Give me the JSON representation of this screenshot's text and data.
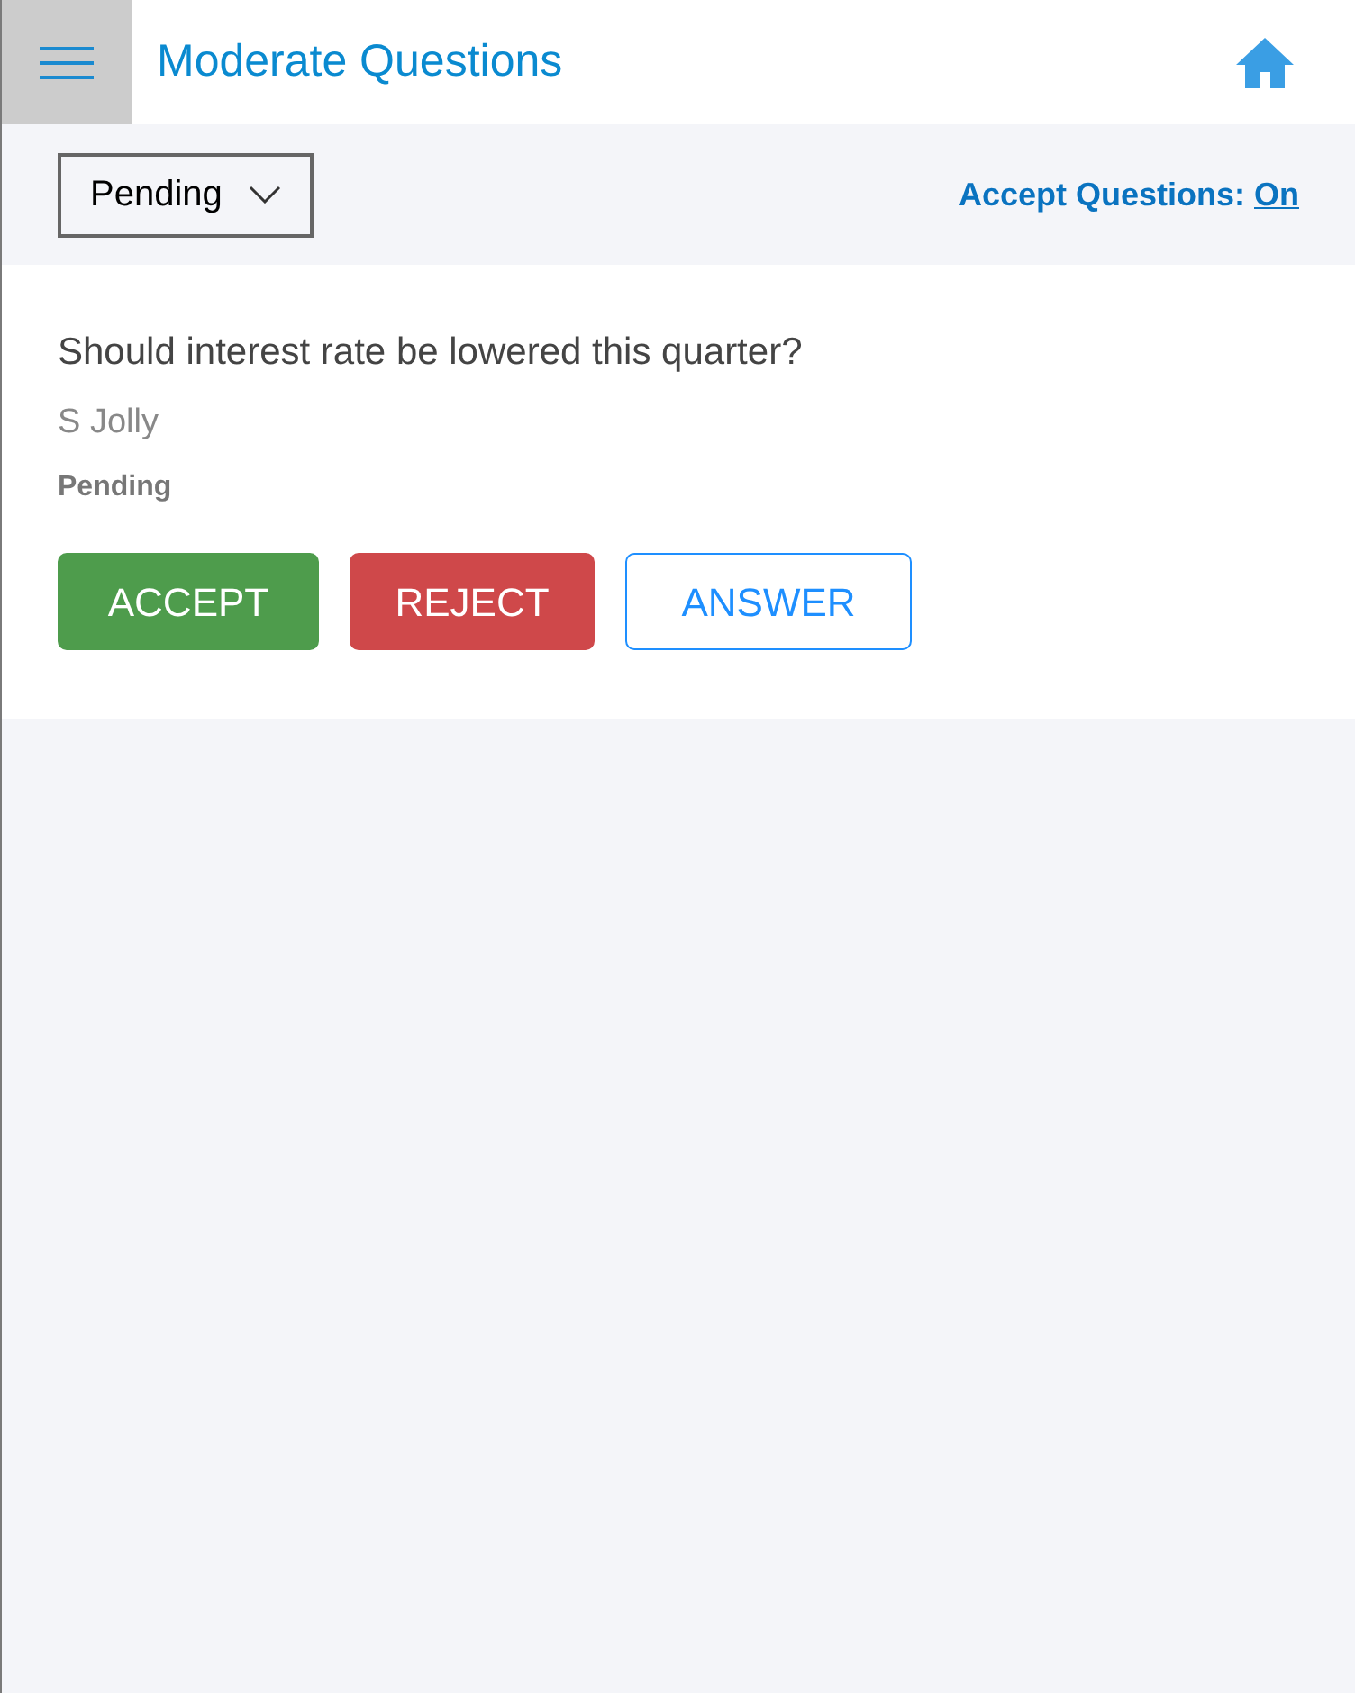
{
  "header": {
    "title": "Moderate Questions"
  },
  "toolbar": {
    "filter": {
      "value": "Pending"
    },
    "accept_questions": {
      "label": "Accept Questions:",
      "value": "On"
    }
  },
  "questions": [
    {
      "text": "Should interest rate be lowered this quarter?",
      "author": "S Jolly",
      "status": "Pending",
      "actions": [
        {
          "label": "ACCEPT",
          "kind": "accept"
        },
        {
          "label": "REJECT",
          "kind": "reject"
        },
        {
          "label": "ANSWER",
          "kind": "answer"
        }
      ]
    }
  ]
}
